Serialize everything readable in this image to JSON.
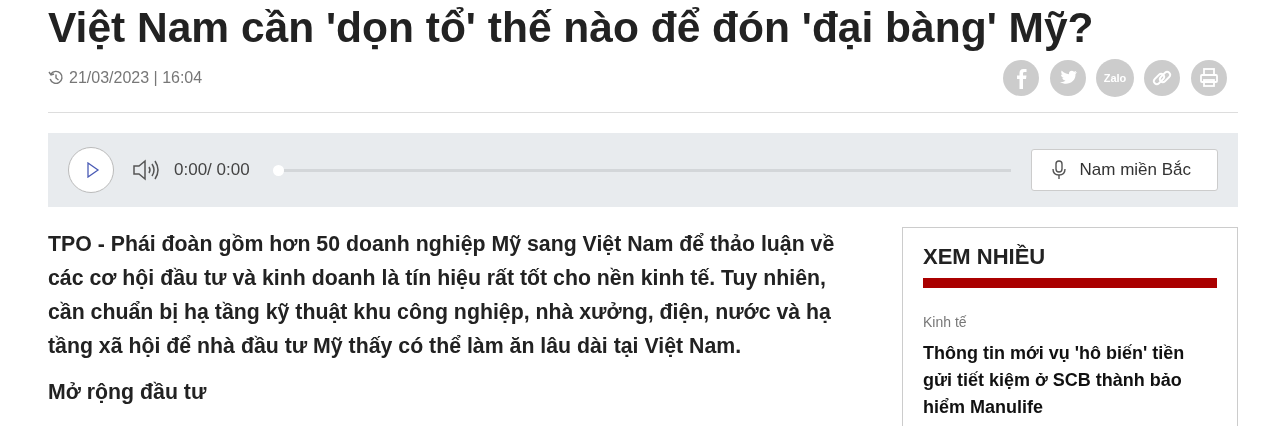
{
  "article": {
    "title": "Việt Nam cần 'dọn tổ' thế nào để đón 'đại bàng' Mỹ?",
    "datetime": "21/03/2023 | 16:04"
  },
  "share": [
    {
      "kind": "facebook"
    },
    {
      "kind": "twitter"
    },
    {
      "kind": "zalo",
      "label": "Zalo"
    },
    {
      "kind": "link"
    },
    {
      "kind": "print"
    }
  ],
  "audio": {
    "time": "0:00/ 0:00",
    "level": 0,
    "voice": "Nam miền Bắc"
  },
  "body": {
    "lead": "TPO - Phái đoàn gồm hơn 50 doanh nghiệp Mỹ sang Việt Nam để thảo luận về các cơ hội đầu tư và kinh doanh là tín hiệu rất tốt cho nền kinh tế. Tuy nhiên, cần chuẩn bị hạ tầng kỹ thuật khu công nghiệp, nhà xưởng, điện, nước và hạ tầng xã hội để nhà đầu tư Mỹ thấy có thể làm ăn lâu dài tại Việt Nam.",
    "subheading": "Mở rộng đầu tư"
  },
  "sidebar": {
    "title": "XEM NHIỀU",
    "items": [
      {
        "category": "Kinh tế",
        "headline": "Thông tin mới vụ 'hô biến' tiền gửi tiết kiệm ở SCB thành bảo hiểm Manulife"
      }
    ]
  }
}
